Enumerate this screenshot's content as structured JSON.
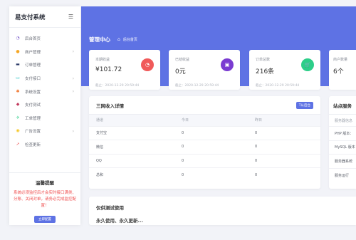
{
  "sidebar": {
    "title": "易支付系统",
    "toggle_icon": "menu-collapse-icon",
    "items": [
      {
        "label": "后台首页",
        "icon": "dashboard-icon",
        "color": "#8a6fd1",
        "chevron": false
      },
      {
        "label": "商户管理",
        "icon": "user-icon",
        "color": "#f5a623",
        "chevron": true
      },
      {
        "label": "订单管理",
        "icon": "order-icon",
        "color": "#2b3a67",
        "chevron": false
      },
      {
        "label": "支付接口",
        "icon": "payment-card-icon",
        "color": "#1fc1c3",
        "chevron": true
      },
      {
        "label": "系统设置",
        "icon": "gear-icon",
        "color": "#f0762f",
        "chevron": true
      },
      {
        "label": "支付测试",
        "icon": "test-icon",
        "color": "#c23a5e",
        "chevron": false
      },
      {
        "label": "工单管理",
        "icon": "ticket-icon",
        "color": "#2dce89",
        "chevron": false
      },
      {
        "label": "广告设置",
        "icon": "ad-icon",
        "color": "#f5c623",
        "chevron": true
      },
      {
        "label": "检查更新",
        "icon": "update-icon",
        "color": "#f06262",
        "chevron": false
      }
    ],
    "notice": {
      "title": "温馨提醒",
      "text": "系统必须监控后才会实时接口满类、分账、关闭对单，请务必完成监控配置！",
      "button": "立即配置"
    }
  },
  "header": {
    "title": "管理中心",
    "breadcrumb": "后台首页"
  },
  "stats": [
    {
      "label": "本期收益",
      "value": "¥101.72",
      "time": "截止：2020-12-29 20:59:44",
      "icon": "pie-chart-icon",
      "color": "#f05a5a"
    },
    {
      "label": "已结收益",
      "value": "0元",
      "time": "截止：2020-12-29 20:59:44",
      "icon": "wallet-icon",
      "color": "#7a3bd1"
    },
    {
      "label": "订单总数",
      "value": "216条",
      "time": "截止：2020-12-29 20:59:44",
      "icon": "cart-icon",
      "color": "#2dce89"
    },
    {
      "label": "商户数量",
      "value": "6个",
      "time": "",
      "icon": "",
      "color": ""
    }
  ],
  "income": {
    "title": "三网收入详情",
    "tag": "T从后台",
    "columns": [
      "通道",
      "今日",
      "昨日"
    ],
    "rows": [
      [
        "支付宝",
        "0",
        "0"
      ],
      [
        "微信",
        "0",
        "0"
      ],
      [
        "QQ",
        "0",
        "0"
      ],
      [
        "总和",
        "0",
        "0"
      ]
    ]
  },
  "site": {
    "title": "站点服务",
    "items": [
      "服务器信息",
      "PHP 版本：",
      "MySQL 版本",
      "服务器系统",
      "服务运行"
    ]
  },
  "test": {
    "title": "仅供测试使用",
    "text": "永久使用、永久更新..."
  }
}
